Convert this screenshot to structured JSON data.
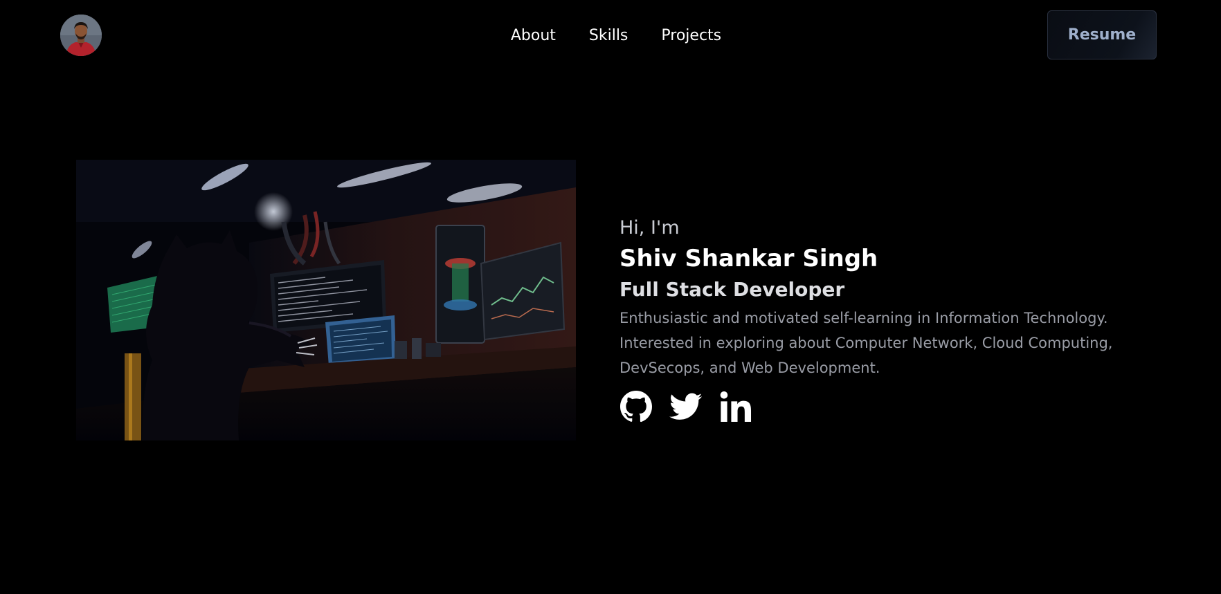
{
  "nav": {
    "avatar_alt": "Profile photo",
    "links": [
      {
        "label": "About"
      },
      {
        "label": "Skills"
      },
      {
        "label": "Projects"
      }
    ],
    "resume_label": "Resume"
  },
  "hero": {
    "greeting": "Hi, I'm",
    "name": "Shiv Shankar Singh",
    "role": "Full Stack Developer",
    "bio": "Enthusiastic and motivated self-learning in Information Technology. Interested in exploring about Computer Network, Cloud Computing, DevSecops, and Web Development.",
    "socials": [
      {
        "icon": "github-icon"
      },
      {
        "icon": "twitter-icon"
      },
      {
        "icon": "linkedin-icon"
      }
    ]
  },
  "colors": {
    "background": "#000000",
    "text_primary": "#ffffff",
    "text_muted": "#9a9da6",
    "button_text": "#9fb0cc",
    "button_border": "#2a3140"
  }
}
